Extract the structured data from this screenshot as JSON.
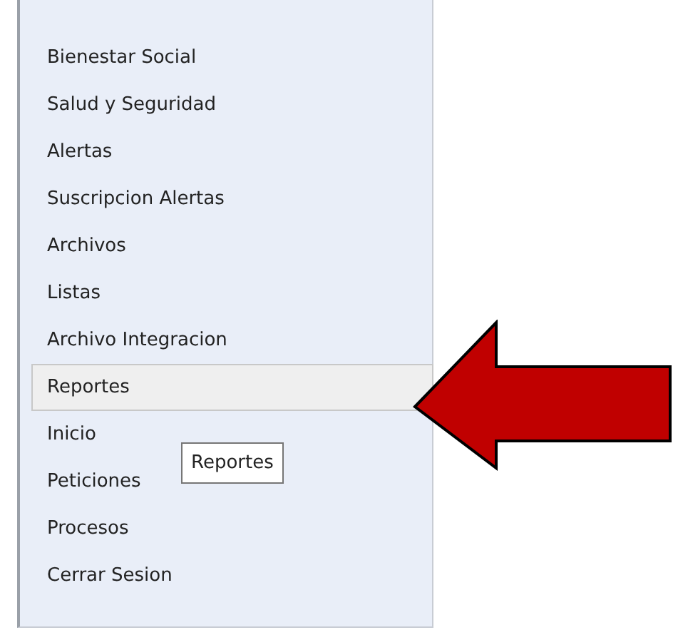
{
  "menu": {
    "items": [
      {
        "label": "Bienestar Social",
        "selected": false
      },
      {
        "label": "Salud y Seguridad",
        "selected": false
      },
      {
        "label": "Alertas",
        "selected": false
      },
      {
        "label": "Suscripcion Alertas",
        "selected": false
      },
      {
        "label": "Archivos",
        "selected": false
      },
      {
        "label": "Listas",
        "selected": false
      },
      {
        "label": "Archivo Integracion",
        "selected": false
      },
      {
        "label": "Reportes",
        "selected": true
      },
      {
        "label": "Inicio",
        "selected": false
      },
      {
        "label": "Peticiones",
        "selected": false
      },
      {
        "label": "Procesos",
        "selected": false
      },
      {
        "label": "Cerrar Sesion",
        "selected": false
      }
    ]
  },
  "tooltip": {
    "text": "Reportes"
  }
}
